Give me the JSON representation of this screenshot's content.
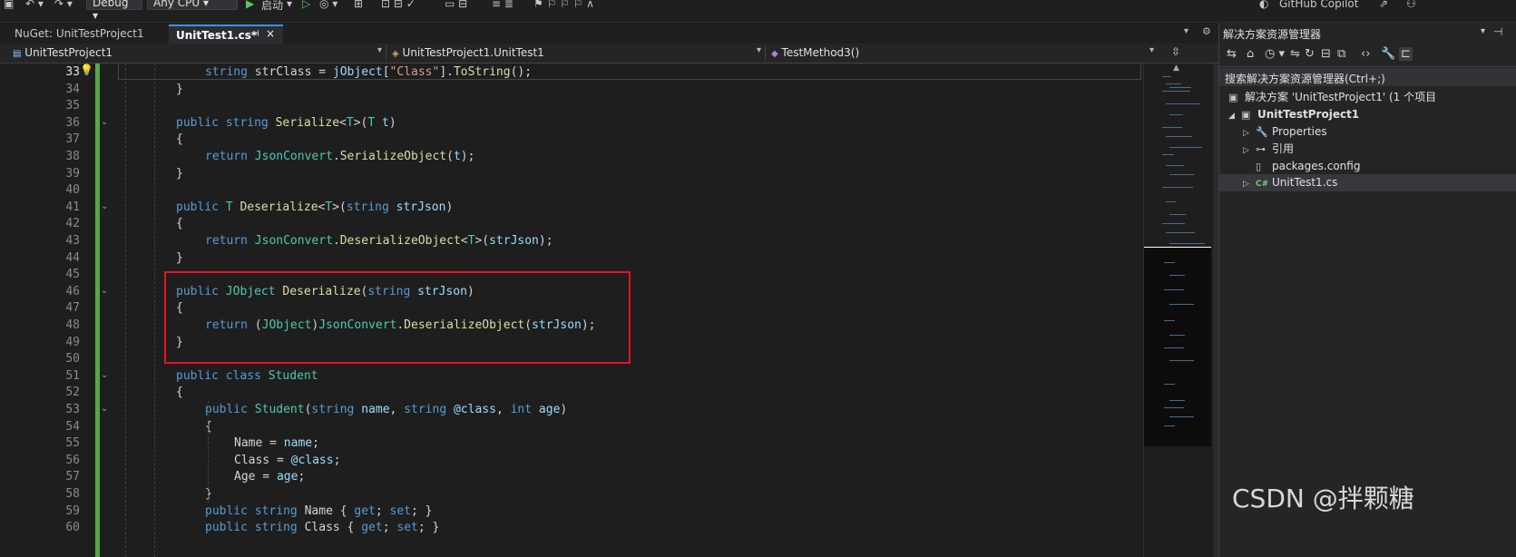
{
  "toolbar": {
    "config_value": "Debug",
    "platform_value": "Any CPU",
    "start_label": "启动",
    "copilot_label": "GitHub Copilot"
  },
  "tabs": [
    {
      "label": "NuGet: UnitTestProject1"
    },
    {
      "label": "UnitTest1.cs*",
      "pin": "⊣",
      "close": "×"
    }
  ],
  "navbar": {
    "project": "UnitTestProject1",
    "class": "UnitTestProject1.UnitTest1",
    "member": "TestMethod3()"
  },
  "editor": {
    "line_numbers": [
      "33",
      "34",
      "35",
      "36",
      "37",
      "38",
      "39",
      "40",
      "41",
      "42",
      "43",
      "44",
      "45",
      "46",
      "47",
      "48",
      "49",
      "50",
      "51",
      "52",
      "53",
      "54",
      "55",
      "56",
      "57",
      "58",
      "59",
      "60"
    ],
    "current_line": "33",
    "lines": [
      [
        [
          "kw",
          "string "
        ],
        [
          "pl",
          "strClass = "
        ],
        [
          "pm",
          "jObject"
        ],
        [
          "pl",
          "["
        ],
        [
          "st",
          "\"Class\""
        ],
        [
          "pl",
          "]."
        ],
        [
          "fn",
          "ToString"
        ],
        [
          "pl",
          "();"
        ]
      ],
      [
        [
          "pl",
          "}"
        ]
      ],
      [],
      [
        [
          "kw",
          "public "
        ],
        [
          "kw",
          "string "
        ],
        [
          "fn",
          "Serialize"
        ],
        [
          "pl",
          "<"
        ],
        [
          "ty",
          "T"
        ],
        [
          "pl",
          ">("
        ],
        [
          "ty",
          "T "
        ],
        [
          "pm",
          "t"
        ],
        [
          "pl",
          ")"
        ]
      ],
      [
        [
          "pl",
          "{"
        ]
      ],
      [
        [
          "kw",
          "return "
        ],
        [
          "ty",
          "JsonConvert"
        ],
        [
          "pl",
          "."
        ],
        [
          "fn",
          "SerializeObject"
        ],
        [
          "pl",
          "("
        ],
        [
          "pm",
          "t"
        ],
        [
          "pl",
          ");"
        ]
      ],
      [
        [
          "pl",
          "}"
        ]
      ],
      [],
      [
        [
          "kw",
          "public "
        ],
        [
          "ty",
          "T "
        ],
        [
          "fn",
          "Deserialize"
        ],
        [
          "pl",
          "<"
        ],
        [
          "ty",
          "T"
        ],
        [
          "pl",
          ">("
        ],
        [
          "kw",
          "string "
        ],
        [
          "pm",
          "strJson"
        ],
        [
          "pl",
          ")"
        ]
      ],
      [
        [
          "pl",
          "{"
        ]
      ],
      [
        [
          "kw",
          "return "
        ],
        [
          "ty",
          "JsonConvert"
        ],
        [
          "pl",
          "."
        ],
        [
          "fn",
          "DeserializeObject"
        ],
        [
          "pl",
          "<"
        ],
        [
          "ty",
          "T"
        ],
        [
          "pl",
          ">("
        ],
        [
          "pm",
          "strJson"
        ],
        [
          "pl",
          ");"
        ]
      ],
      [
        [
          "pl",
          "}"
        ]
      ],
      [],
      [
        [
          "kw",
          "public "
        ],
        [
          "ty",
          "JObject "
        ],
        [
          "fn",
          "Deserialize"
        ],
        [
          "pl",
          "("
        ],
        [
          "kw",
          "string "
        ],
        [
          "pm",
          "strJson"
        ],
        [
          "pl",
          ")"
        ]
      ],
      [
        [
          "pl",
          "{"
        ]
      ],
      [
        [
          "kw",
          "return "
        ],
        [
          "pl",
          "("
        ],
        [
          "ty",
          "JObject"
        ],
        [
          "pl",
          ")"
        ],
        [
          "ty",
          "JsonConvert"
        ],
        [
          "pl",
          "."
        ],
        [
          "fn",
          "DeserializeObject"
        ],
        [
          "pl",
          "("
        ],
        [
          "pm",
          "strJson"
        ],
        [
          "pl",
          ");"
        ]
      ],
      [
        [
          "pl",
          "}"
        ]
      ],
      [],
      [
        [
          "kw",
          "public "
        ],
        [
          "kw",
          "class "
        ],
        [
          "ty",
          "Student"
        ]
      ],
      [
        [
          "pl",
          "{"
        ]
      ],
      [
        [
          "kw",
          "public "
        ],
        [
          "ty",
          "Student"
        ],
        [
          "pl",
          "("
        ],
        [
          "kw",
          "string "
        ],
        [
          "pm",
          "name"
        ],
        [
          "pl",
          ", "
        ],
        [
          "kw",
          "string "
        ],
        [
          "pm",
          "@class"
        ],
        [
          "pl",
          ", "
        ],
        [
          "kw",
          "int "
        ],
        [
          "pm",
          "age"
        ],
        [
          "pl",
          ")"
        ]
      ],
      [
        [
          "pl",
          "{"
        ]
      ],
      [
        [
          "pl",
          "Name = "
        ],
        [
          "pm",
          "name"
        ],
        [
          "pl",
          ";"
        ]
      ],
      [
        [
          "pl",
          "Class = "
        ],
        [
          "pm",
          "@class"
        ],
        [
          "pl",
          ";"
        ]
      ],
      [
        [
          "pl",
          "Age = "
        ],
        [
          "pm",
          "age"
        ],
        [
          "pl",
          ";"
        ]
      ],
      [
        [
          "pl",
          "}"
        ]
      ],
      [
        [
          "kw",
          "public "
        ],
        [
          "kw",
          "string "
        ],
        [
          "pl",
          "Name { "
        ],
        [
          "kw",
          "get"
        ],
        [
          "pl",
          "; "
        ],
        [
          "kw",
          "set"
        ],
        [
          "pl",
          "; }"
        ]
      ],
      [
        [
          "kw",
          "public "
        ],
        [
          "kw",
          "string "
        ],
        [
          "pl",
          "Class { "
        ],
        [
          "kw",
          "get"
        ],
        [
          "pl",
          "; "
        ],
        [
          "kw",
          "set"
        ],
        [
          "pl",
          "; }"
        ]
      ]
    ]
  },
  "solution_explorer": {
    "title": "解决方案资源管理器",
    "search_placeholder": "搜索解决方案资源管理器(Ctrl+;)",
    "items": [
      {
        "label": "解决方案 'UnitTestProject1' (1 个项目",
        "icon": "solution-icon"
      },
      {
        "label": "UnitTestProject1",
        "icon": "csharp-project-icon"
      },
      {
        "label": "Properties",
        "icon": "wrench-icon"
      },
      {
        "label": "引用",
        "icon": "references-icon"
      },
      {
        "label": "packages.config",
        "icon": "config-file-icon"
      },
      {
        "label": "UnitTest1.cs",
        "icon": "csharp-file-icon",
        "badge": "C#"
      }
    ]
  },
  "watermark": "CSDN @拌颗糖"
}
